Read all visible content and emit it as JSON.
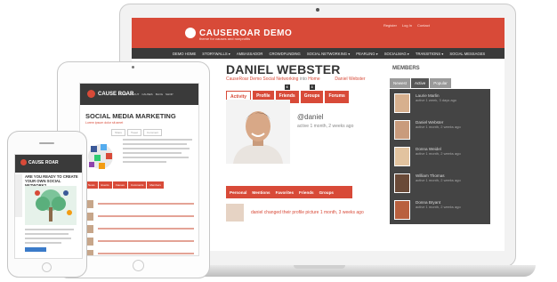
{
  "laptop": {
    "brand": "CAUSEROAR DEMO",
    "tagline": "theme for causes and nonprofits",
    "top_links": [
      "Register",
      "Log In",
      "Contact"
    ],
    "nav": [
      "DEMO HOME",
      "STORYWALLS ▾",
      "AMBASSADOR",
      "CROWDFUNDING",
      "SOCIAL NETWORKING ▾",
      "PEARLING ▾",
      "SOCIALMAG ▾",
      "TRANSITIONS ▾",
      "SOCIAL MESSAGES"
    ],
    "profile": {
      "name": "DANIEL WEBSTER",
      "breadcrumb": "CauseRoar Demo Social Networking",
      "breadcrumb_sep": "into",
      "breadcrumb_home": "Home",
      "breadcrumb_user": "Daniel Webster",
      "tabs": [
        {
          "label": "Activity",
          "badge": ""
        },
        {
          "label": "Profile",
          "badge": ""
        },
        {
          "label": "Friends",
          "badge": "6"
        },
        {
          "label": "Groups",
          "badge": "3"
        },
        {
          "label": "Forums",
          "badge": ""
        }
      ],
      "handle": "@daniel",
      "active_since": "active 1 month, 2 weeks ago",
      "subtabs": [
        "Personal",
        "Mentions",
        "Favorites",
        "Friends",
        "Groups"
      ],
      "activity_text": "daniel changed their profile picture 1 month, 3 weeks ago"
    },
    "members": {
      "heading": "MEMBERS",
      "tabs": [
        "Newest",
        "Active",
        "Popular"
      ],
      "list": [
        {
          "name": "Laurie Marlin",
          "time": "active 1 week, 3 days ago"
        },
        {
          "name": "Daniel Webster",
          "time": "active 1 month, 2 weeks ago"
        },
        {
          "name": "Donna Weidel",
          "time": "active 1 month, 2 weeks ago"
        },
        {
          "name": "William Thomas",
          "time": "active 1 month, 2 weeks ago"
        },
        {
          "name": "Donna Bryant",
          "time": "active 1 month, 2 weeks ago"
        }
      ]
    }
  },
  "tablet": {
    "brand": "CAUSE ROAR",
    "nav": [
      "HOME",
      "ABOUT",
      "CAUSES",
      "BLOG",
      "SHOP"
    ],
    "title": "SOCIAL MEDIA MARKETING",
    "subtitle": "Lorem ipsum dolor sit amet",
    "buttons": [
      "Share",
      "Tweet",
      "Comment"
    ],
    "tabs": [
      "News",
      "Events",
      "Causes",
      "Comments",
      "Members"
    ]
  },
  "phone": {
    "brand": "CAUSE ROAR",
    "headline": "ARE YOU READY TO CREATE YOUR OWN SOCIAL NETWORK?"
  },
  "colors": {
    "accent": "#d84a38",
    "dark": "#3a3a3a"
  }
}
